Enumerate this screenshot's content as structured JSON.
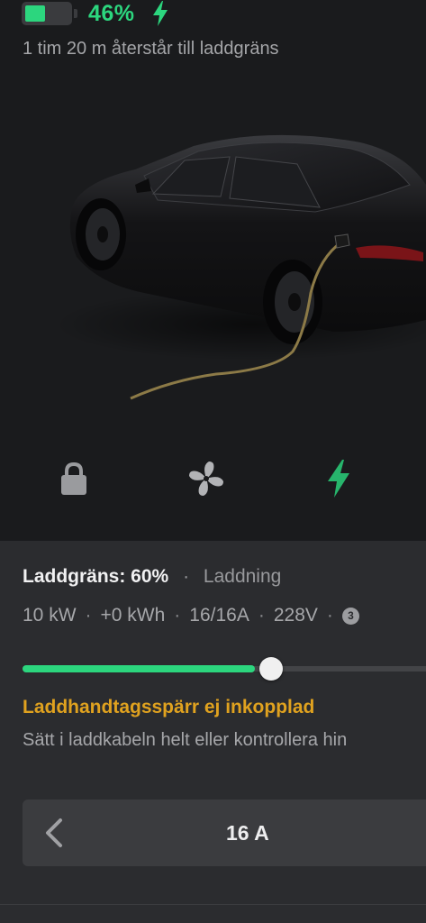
{
  "status": {
    "battery_percent_label": "46%",
    "battery_level": 0.46,
    "time_remaining": "1 tim 20 m återstår till laddgräns",
    "accent_color": "#2cd67e"
  },
  "controls": [
    {
      "name": "lock",
      "icon": "lock-icon"
    },
    {
      "name": "climate",
      "icon": "fan-icon"
    },
    {
      "name": "charging",
      "icon": "bolt-icon"
    }
  ],
  "charging": {
    "limit_label": "Laddgräns: 60%",
    "separator": "·",
    "state": "Laddning",
    "power": "10 kW",
    "energy_added": "+0 kWh",
    "current": "16/16A",
    "voltage": "228V",
    "phases": "3",
    "current_level": 0.56,
    "limit_level": 0.6,
    "warning_title": "Laddhandtagsspärr ej inkopplad",
    "warning_text": "Sätt i laddkabeln helt eller kontrollera hin",
    "warning_color": "#e0a21f",
    "amps_value": "16 A"
  }
}
